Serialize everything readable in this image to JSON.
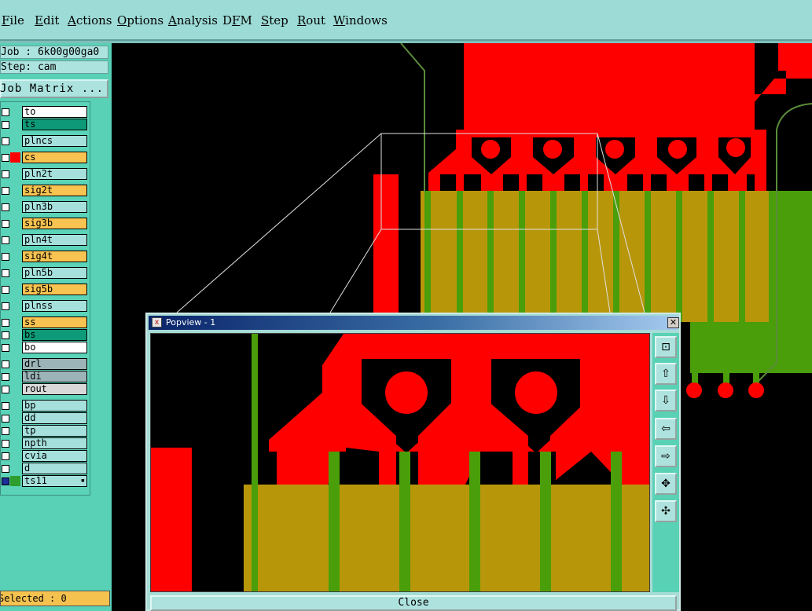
{
  "menu": [
    {
      "key": "file",
      "label": "File",
      "underline": 0
    },
    {
      "key": "edit",
      "label": "Edit",
      "underline": 0
    },
    {
      "key": "actions",
      "label": "Actions",
      "underline": 0
    },
    {
      "key": "options",
      "label": "Options",
      "underline": 0
    },
    {
      "key": "analysis",
      "label": "Analysis",
      "underline": 0
    },
    {
      "key": "dfm",
      "label": "DFM",
      "underline": 1
    },
    {
      "key": "step",
      "label": "Step",
      "underline": 0
    },
    {
      "key": "rout",
      "label": "Rout",
      "underline": 0
    },
    {
      "key": "windows",
      "label": "Windows",
      "underline": 0
    }
  ],
  "job": {
    "job_line": "Job : 6k00g00ga0",
    "step_line": "Step: cam",
    "matrix_button": "Job Matrix ..."
  },
  "layers": [
    {
      "name": "to",
      "bg": "#ffffff",
      "swatch": ""
    },
    {
      "name": "ts",
      "bg": "#0e9a78",
      "swatch": ""
    },
    {
      "name": "plncs",
      "bg": "#a6e0dc",
      "swatch": ""
    },
    {
      "name": "cs",
      "bg": "#f8c350",
      "swatch": "#ff0000"
    },
    {
      "name": "pln2t",
      "bg": "#a6e0dc",
      "swatch": ""
    },
    {
      "name": "sig2t",
      "bg": "#f8c350",
      "swatch": ""
    },
    {
      "name": "pln3b",
      "bg": "#a6e0dc",
      "swatch": ""
    },
    {
      "name": "sig3b",
      "bg": "#f8c350",
      "swatch": ""
    },
    {
      "name": "pln4t",
      "bg": "#a6e0dc",
      "swatch": ""
    },
    {
      "name": "sig4t",
      "bg": "#f8c350",
      "swatch": ""
    },
    {
      "name": "pln5b",
      "bg": "#a6e0dc",
      "swatch": ""
    },
    {
      "name": "sig5b",
      "bg": "#f8c350",
      "swatch": ""
    },
    {
      "name": "plnss",
      "bg": "#a6e0dc",
      "swatch": ""
    },
    {
      "name": "ss",
      "bg": "#f8c350",
      "swatch": ""
    },
    {
      "name": "bs",
      "bg": "#0e9a78",
      "swatch": ""
    },
    {
      "name": "bo",
      "bg": "#ffffff",
      "swatch": ""
    },
    {
      "name": "drl",
      "bg": "#9cb4b8",
      "swatch": ""
    },
    {
      "name": "ldi",
      "bg": "#9cb4b8",
      "swatch": ""
    },
    {
      "name": "rout",
      "bg": "#d8d8d8",
      "swatch": ""
    },
    {
      "name": "bp",
      "bg": "#a6e0dc",
      "swatch": ""
    },
    {
      "name": "dd",
      "bg": "#a6e0dc",
      "swatch": ""
    },
    {
      "name": "tp",
      "bg": "#a6e0dc",
      "swatch": ""
    },
    {
      "name": "npth",
      "bg": "#a6e0dc",
      "swatch": ""
    },
    {
      "name": "cvia",
      "bg": "#a6e0dc",
      "swatch": ""
    },
    {
      "name": "d",
      "bg": "#a6e0dc",
      "swatch": ""
    },
    {
      "name": "ts11",
      "bg": "#a6e0dc",
      "swatch": "#2e9e2e",
      "active": true
    }
  ],
  "selected_text": "Selected : 0",
  "popview": {
    "title": "Popview - 1",
    "close_label": "Close",
    "tools": [
      "zoom-fit-icon",
      "pan-up-icon",
      "pan-down-icon",
      "pan-left-icon",
      "pan-right-icon",
      "zoom-in-icon",
      "zoom-out-icon"
    ]
  },
  "colors": {
    "copper": "#ff0000",
    "mask_overlap": "#b8960a",
    "gold_finger": "#4a9e0a",
    "outline": "#5a8c3a",
    "panel_bg": "#58d1b6",
    "menubar_bg": "#9ddbd6"
  }
}
